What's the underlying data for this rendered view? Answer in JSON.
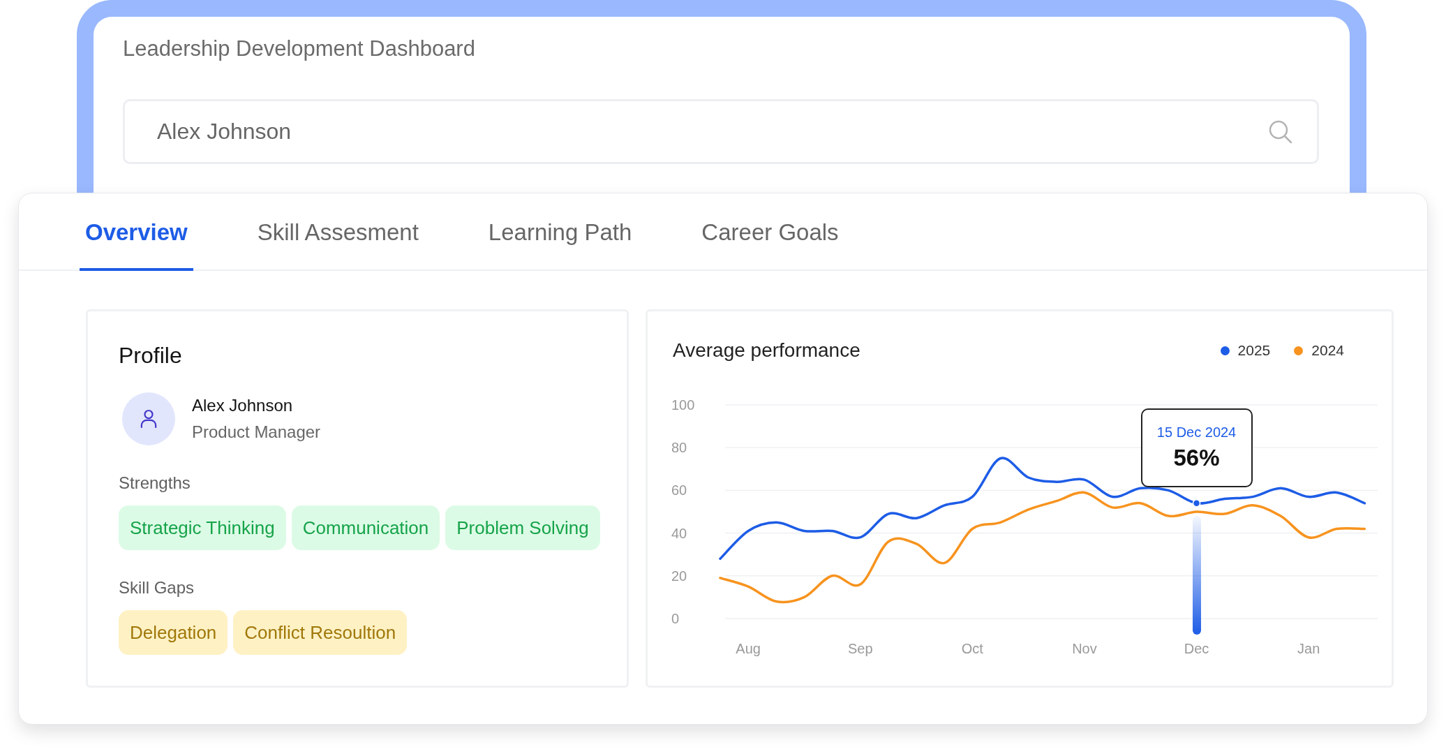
{
  "header": {
    "title": "Leadership Development Dashboard"
  },
  "search": {
    "value": "Alex Johnson"
  },
  "tabs": [
    {
      "label": "Overview",
      "selected": true
    },
    {
      "label": "Skill Assesment",
      "selected": false
    },
    {
      "label": "Learning Path",
      "selected": false
    },
    {
      "label": "Career Goals",
      "selected": false
    }
  ],
  "profile": {
    "title": "Profile",
    "name": "Alex Johnson",
    "role": "Product Manager",
    "strengths_label": "Strengths",
    "strengths": [
      "Strategic Thinking",
      "Communication",
      "Problem Solving"
    ],
    "skill_gaps_label": "Skill Gaps",
    "skill_gaps": [
      "Delegation",
      "Conflict Resoultion"
    ]
  },
  "performance": {
    "title": "Average performance",
    "tooltip": {
      "date": "15 Dec 2024",
      "value": "56%"
    },
    "chart_data": {
      "type": "line",
      "grid": true,
      "ylim": [
        0,
        100
      ],
      "yticks": [
        0,
        20,
        40,
        60,
        80,
        100
      ],
      "categories": [
        null,
        "Aug",
        null,
        null,
        null,
        "Sep",
        null,
        null,
        null,
        "Oct",
        null,
        null,
        null,
        "Nov",
        null,
        null,
        null,
        "Dec",
        null,
        null,
        null,
        "Jan",
        null,
        null
      ],
      "series": [
        {
          "name": "2025",
          "color": "#1d5ce6",
          "values": [
            28,
            41,
            45,
            41,
            41,
            38,
            49,
            47,
            53,
            57,
            75,
            66,
            64,
            65,
            57,
            61,
            60,
            54,
            56,
            57,
            61,
            57,
            59,
            54
          ]
        },
        {
          "name": "2024",
          "color": "#f7931e",
          "values": [
            19,
            15,
            8,
            10,
            20,
            16,
            36,
            35,
            26,
            42,
            45,
            51,
            55,
            59,
            52,
            54,
            48,
            50,
            49,
            53,
            48,
            38,
            42,
            42
          ]
        }
      ]
    }
  }
}
